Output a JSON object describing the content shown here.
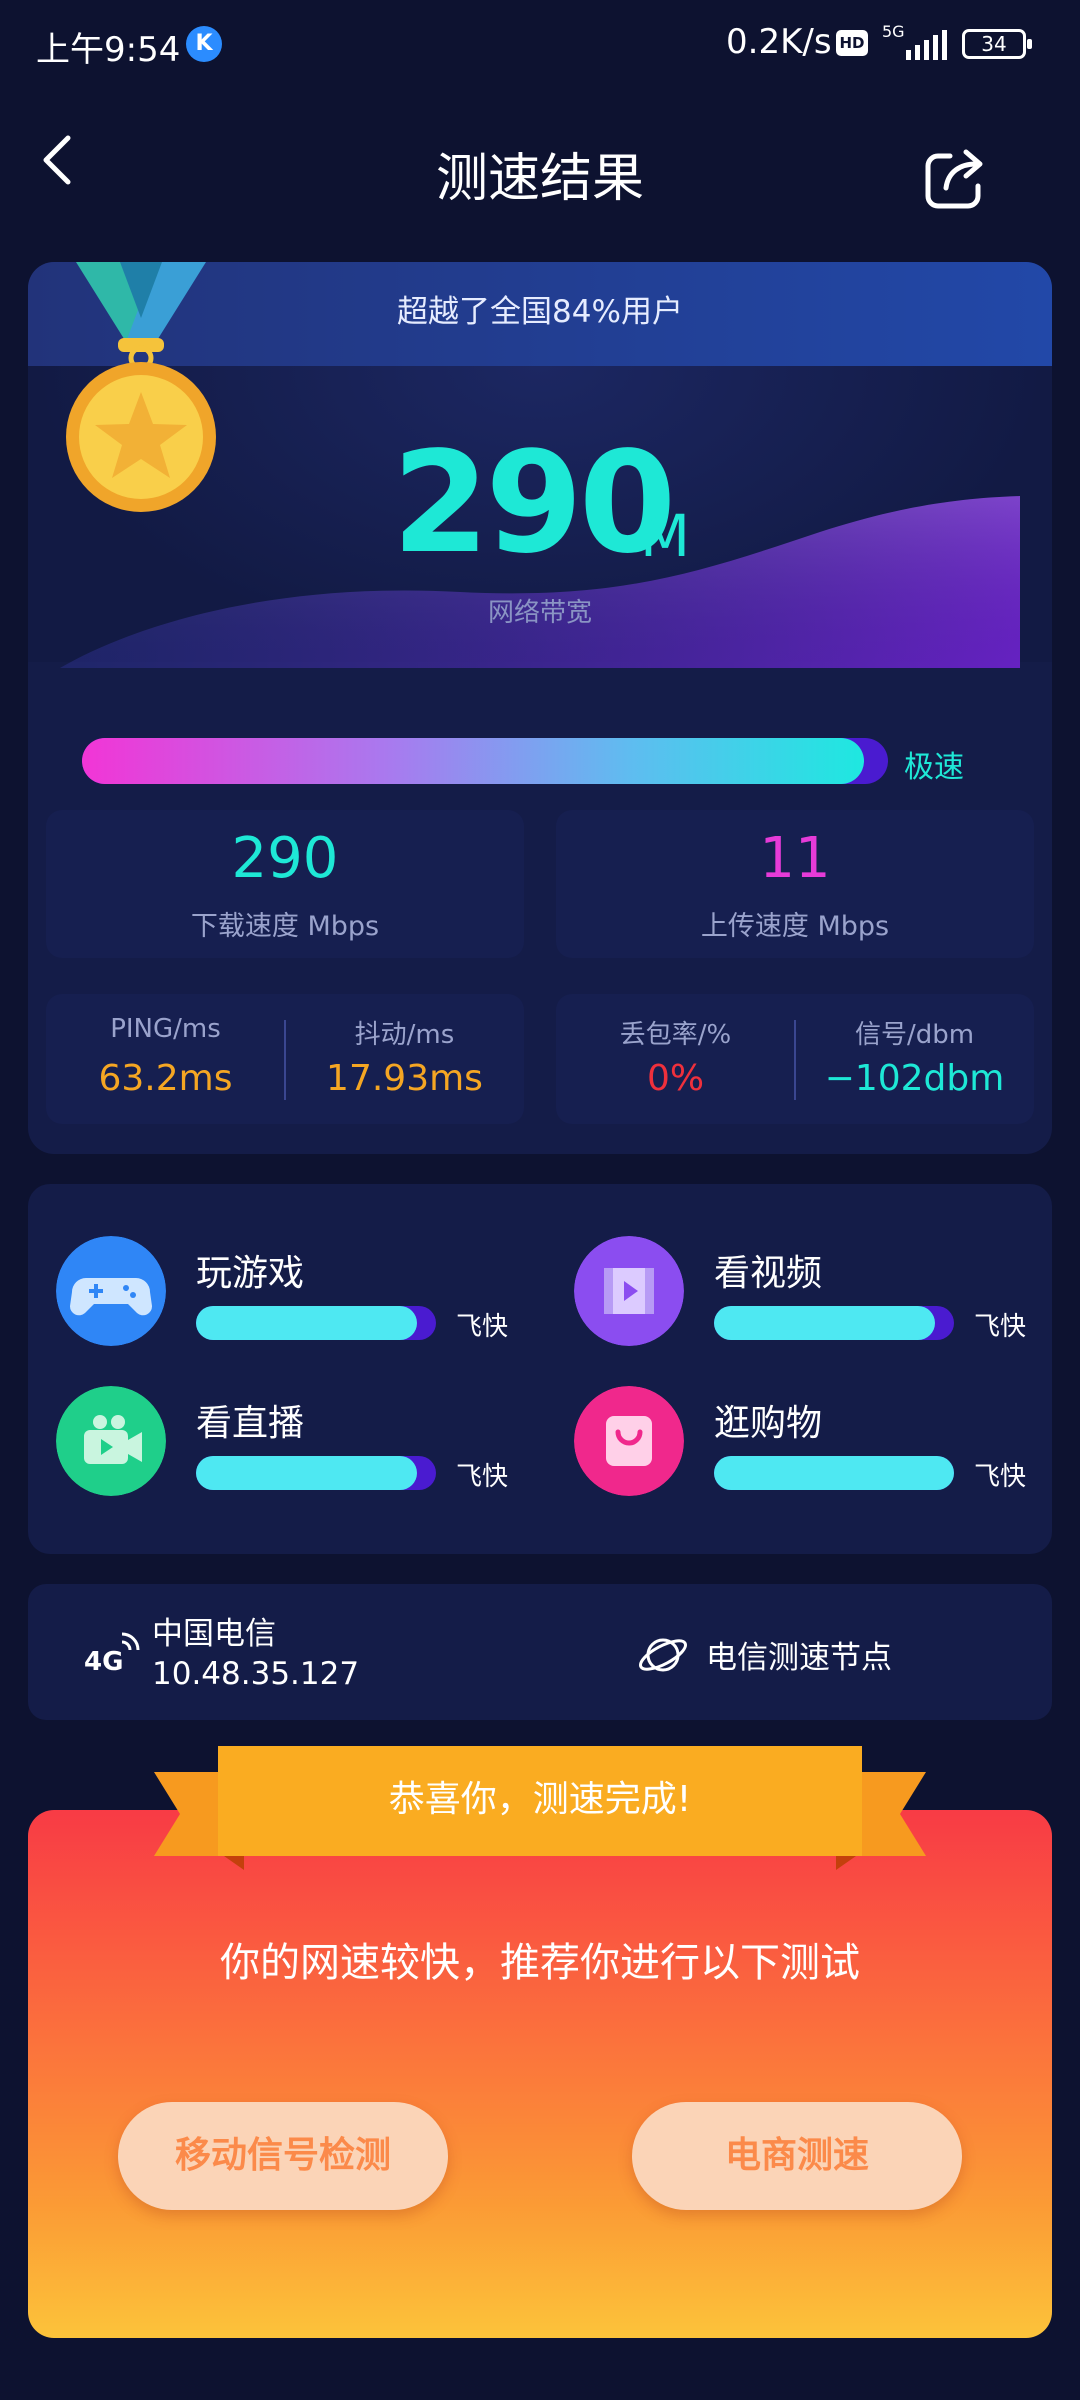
{
  "status_bar": {
    "time": "上午9:54",
    "app_badge": "K",
    "net_speed": "0.2K/s",
    "hd": "HD",
    "network": "5G",
    "battery": "34"
  },
  "header": {
    "title": "测速结果",
    "back_icon": "chevron-left-icon",
    "share_icon": "share-icon"
  },
  "result": {
    "rank_text": "超越了全国84%用户",
    "bandwidth_value": "290",
    "bandwidth_unit": "M",
    "bandwidth_caption": "网络带宽",
    "speed_level_fraction": 0.97,
    "speed_level_label": "极速",
    "download": {
      "value": "290",
      "label": "下载速度  Mbps",
      "color": "#1ee8d6"
    },
    "upload": {
      "value": "11",
      "label": "上传速度  Mbps",
      "color": "#e63bd8"
    },
    "metrics": [
      {
        "title": "PING/ms",
        "value": "63.2ms",
        "color": "#f5a623"
      },
      {
        "title": "抖动/ms",
        "value": "17.93ms",
        "color": "#f5a623"
      },
      {
        "title": "丢包率/%",
        "value": "0%",
        "color": "#f0303c"
      },
      {
        "title": "信号/dbm",
        "value": "−102dbm",
        "color": "#1ee8d6"
      }
    ]
  },
  "activities": [
    {
      "name": "玩游戏",
      "status": "飞快",
      "level": 0.92,
      "icon": "gamepad-icon",
      "color": "#2f86f6"
    },
    {
      "name": "看视频",
      "status": "飞快",
      "level": 0.92,
      "icon": "film-icon",
      "color": "#8b4df0"
    },
    {
      "name": "看直播",
      "status": "飞快",
      "level": 0.92,
      "icon": "video-camera-icon",
      "color": "#1fcf8a"
    },
    {
      "name": "逛购物",
      "status": "飞快",
      "level": 1.0,
      "icon": "shopping-bag-icon",
      "color": "#f0288c"
    }
  ],
  "carrier": {
    "network_type": "4G",
    "name": "中国电信",
    "ip": "10.48.35.127",
    "node_label": "电信测速节点"
  },
  "promo": {
    "ribbon_text": "恭喜你，测速完成!",
    "message": "你的网速较快，推荐你进行以下测试",
    "buttons": [
      "移动信号检测",
      "电商测速"
    ]
  }
}
